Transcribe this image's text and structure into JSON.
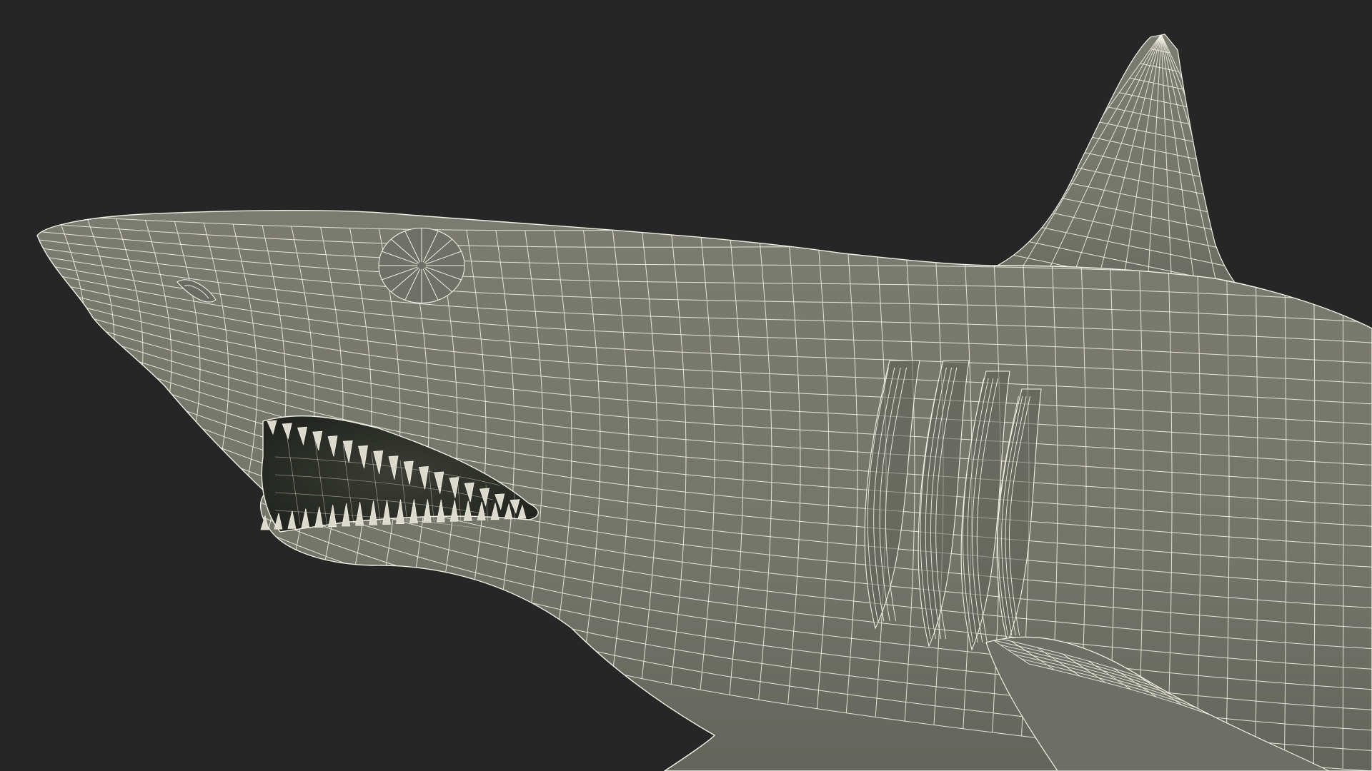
{
  "scene": {
    "background_color": "#262626",
    "mesh_fill_color": "#74756b",
    "mesh_shadow_color": "#5d5e56",
    "wire_color": "#f2f0e4",
    "mouth_color": "#2a2c27",
    "tooth_color": "#dcdacd"
  }
}
